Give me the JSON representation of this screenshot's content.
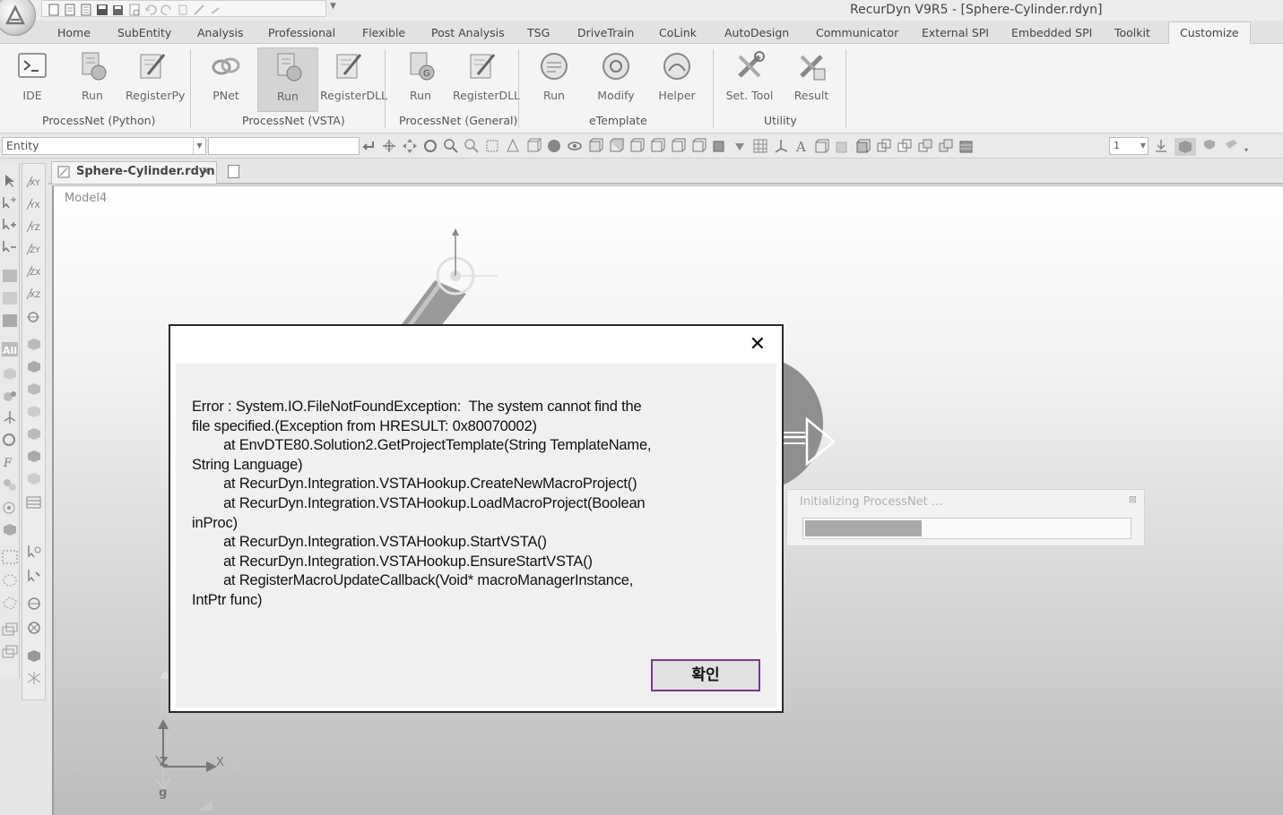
{
  "window": {
    "title": "RecurDyn V9R5  - [Sphere-Cylinder.rdyn]"
  },
  "ribbon": {
    "tabs": [
      {
        "label": "Home"
      },
      {
        "label": "SubEntity"
      },
      {
        "label": "Analysis"
      },
      {
        "label": "Professional"
      },
      {
        "label": "Flexible"
      },
      {
        "label": "Post Analysis"
      },
      {
        "label": "TSG"
      },
      {
        "label": "DriveTrain"
      },
      {
        "label": "CoLink"
      },
      {
        "label": "AutoDesign"
      },
      {
        "label": "Communicator"
      },
      {
        "label": "External SPI"
      },
      {
        "label": "Embedded SPI"
      },
      {
        "label": "Toolkit"
      },
      {
        "label": "Customize"
      }
    ],
    "active_tab": "Customize",
    "buttons": [
      {
        "label": "IDE",
        "icon": "console-icon"
      },
      {
        "label": "Run",
        "icon": "run-python-icon"
      },
      {
        "label": "RegisterPy",
        "icon": "register-python-icon"
      },
      {
        "label": "PNet",
        "icon": "pnet-icon"
      },
      {
        "label": "Run",
        "icon": "run-vsta-icon"
      },
      {
        "label": "RegisterDLL",
        "icon": "register-dll-icon"
      },
      {
        "label": "Run",
        "icon": "run-general-icon"
      },
      {
        "label": "RegisterDLL",
        "icon": "register-dll-general-icon"
      },
      {
        "label": "Run",
        "icon": "etemplate-run-icon"
      },
      {
        "label": "Modify",
        "icon": "etemplate-modify-icon"
      },
      {
        "label": "Helper",
        "icon": "etemplate-helper-icon"
      },
      {
        "label": "Set. Tool",
        "icon": "set-tool-icon"
      },
      {
        "label": "Result",
        "icon": "result-icon"
      }
    ],
    "groups": [
      {
        "label": "ProcessNet (Python)"
      },
      {
        "label": "ProcessNet (VSTA)"
      },
      {
        "label": "ProcessNet (General)"
      },
      {
        "label": "eTemplate"
      },
      {
        "label": "Utility"
      }
    ]
  },
  "toolbar": {
    "entity_combo_value": "Entity",
    "number_combo_value": "1"
  },
  "document": {
    "tab_label": "Sphere-Cylinder.rdyn",
    "tab_close": "×",
    "model_label": "Model4"
  },
  "axes": {
    "z_label": "Z",
    "x_label": "X",
    "g_label": "g"
  },
  "progress": {
    "title": "Initializing ProcessNet ...",
    "fraction": 0.36,
    "close_glyph": "⊠"
  },
  "dialog": {
    "close_glyph": "✕",
    "message": "Error : System.IO.FileNotFoundException:  The system cannot find the\nfile specified.(Exception from HRESULT: 0x80070002)\n        at EnvDTE80.Solution2.GetProjectTemplate(String TemplateName,\nString Language)\n        at RecurDyn.Integration.VSTAHookup.CreateNewMacroProject()\n        at RecurDyn.Integration.VSTAHookup.LoadMacroProject(Boolean\ninProc)\n        at RecurDyn.Integration.VSTAHookup.StartVSTA()\n        at RecurDyn.Integration.VSTAHookup.EnsureStartVSTA()\n        at RegisterMacroUpdateCallback(Void* macroManagerInstance,\nIntPtr func)",
    "ok_label": "확인"
  },
  "colors": {
    "ok_border": "#7a3a8c",
    "progress_fill": "#aaaaaa"
  }
}
